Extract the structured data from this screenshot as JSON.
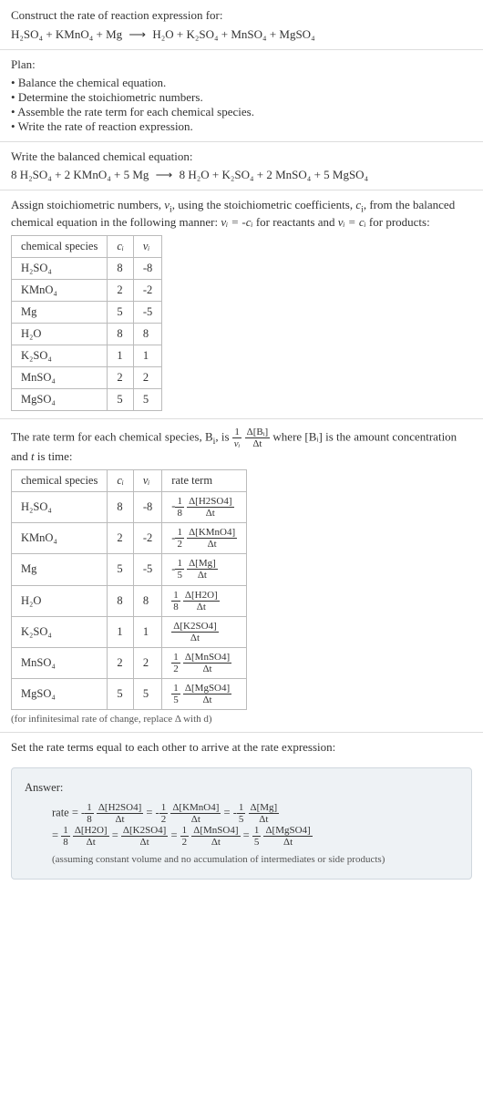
{
  "intro": {
    "prompt": "Construct the rate of reaction expression for:",
    "equation_lhs": "H₂SO₄ + KMnO₄ + Mg",
    "equation_rhs": "H₂O + K₂SO₄ + MnSO₄ + MgSO₄"
  },
  "plan": {
    "title": "Plan:",
    "items": [
      "Balance the chemical equation.",
      "Determine the stoichiometric numbers.",
      "Assemble the rate term for each chemical species.",
      "Write the rate of reaction expression."
    ]
  },
  "balanced": {
    "title": "Write the balanced chemical equation:",
    "lhs": "8 H₂SO₄ + 2 KMnO₄ + 5 Mg",
    "rhs": "8 H₂O + K₂SO₄ + 2 MnSO₄ + 5 MgSO₄"
  },
  "stoich": {
    "title_part1": "Assign stoichiometric numbers, ",
    "title_nu": "ν",
    "title_sub": "i",
    "title_part2": ", using the stoichiometric coefficients, ",
    "title_c": "c",
    "title_part3": ", from the balanced chemical equation in the following manner: ",
    "rel1": "νᵢ = -cᵢ",
    "rel1_after": " for reactants and ",
    "rel2": "νᵢ = cᵢ",
    "rel2_after": " for products:",
    "headers": [
      "chemical species",
      "cᵢ",
      "νᵢ"
    ],
    "rows": [
      {
        "species": "H₂SO₄",
        "c": "8",
        "nu": "-8"
      },
      {
        "species": "KMnO₄",
        "c": "2",
        "nu": "-2"
      },
      {
        "species": "Mg",
        "c": "5",
        "nu": "-5"
      },
      {
        "species": "H₂O",
        "c": "8",
        "nu": "8"
      },
      {
        "species": "K₂SO₄",
        "c": "1",
        "nu": "1"
      },
      {
        "species": "MnSO₄",
        "c": "2",
        "nu": "2"
      },
      {
        "species": "MgSO₄",
        "c": "5",
        "nu": "5"
      }
    ]
  },
  "rate_term": {
    "title_pre": "The rate term for each chemical species, B",
    "title_sub": "i",
    "title_mid": ", is ",
    "frac_coeff_num": "1",
    "frac_coeff_den": "νᵢ",
    "frac_main_num": "Δ[Bᵢ]",
    "frac_main_den": "Δt",
    "title_post1": " where [Bᵢ] is the amount concentration and ",
    "title_t": "t",
    "title_post2": " is time:",
    "headers": [
      "chemical species",
      "cᵢ",
      "νᵢ",
      "rate term"
    ],
    "rows": [
      {
        "species": "H₂SO₄",
        "c": "8",
        "nu": "-8",
        "sign": "-",
        "coeff_num": "1",
        "coeff_den": "8",
        "d_num": "Δ[H2SO4]",
        "d_den": "Δt"
      },
      {
        "species": "KMnO₄",
        "c": "2",
        "nu": "-2",
        "sign": "-",
        "coeff_num": "1",
        "coeff_den": "2",
        "d_num": "Δ[KMnO4]",
        "d_den": "Δt"
      },
      {
        "species": "Mg",
        "c": "5",
        "nu": "-5",
        "sign": "-",
        "coeff_num": "1",
        "coeff_den": "5",
        "d_num": "Δ[Mg]",
        "d_den": "Δt"
      },
      {
        "species": "H₂O",
        "c": "8",
        "nu": "8",
        "sign": "",
        "coeff_num": "1",
        "coeff_den": "8",
        "d_num": "Δ[H2O]",
        "d_den": "Δt"
      },
      {
        "species": "K₂SO₄",
        "c": "1",
        "nu": "1",
        "sign": "",
        "coeff_num": "",
        "coeff_den": "",
        "d_num": "Δ[K2SO4]",
        "d_den": "Δt"
      },
      {
        "species": "MnSO₄",
        "c": "2",
        "nu": "2",
        "sign": "",
        "coeff_num": "1",
        "coeff_den": "2",
        "d_num": "Δ[MnSO4]",
        "d_den": "Δt"
      },
      {
        "species": "MgSO₄",
        "c": "5",
        "nu": "5",
        "sign": "",
        "coeff_num": "1",
        "coeff_den": "5",
        "d_num": "Δ[MgSO4]",
        "d_den": "Δt"
      }
    ],
    "footnote": "(for infinitesimal rate of change, replace Δ with d)"
  },
  "final": {
    "title": "Set the rate terms equal to each other to arrive at the rate expression:"
  },
  "answer": {
    "label": "Answer:",
    "rate_prefix": "rate = ",
    "terms_line1": [
      {
        "sign": "-",
        "num": "1",
        "den": "8",
        "dnum": "Δ[H2SO4]",
        "dden": "Δt"
      },
      {
        "sign": "-",
        "num": "1",
        "den": "2",
        "dnum": "Δ[KMnO4]",
        "dden": "Δt"
      },
      {
        "sign": "-",
        "num": "1",
        "den": "5",
        "dnum": "Δ[Mg]",
        "dden": "Δt"
      }
    ],
    "line2_prefix": "= ",
    "terms_line2": [
      {
        "sign": "",
        "num": "1",
        "den": "8",
        "dnum": "Δ[H2O]",
        "dden": "Δt"
      },
      {
        "sign": "",
        "num": "",
        "den": "",
        "dnum": "Δ[K2SO4]",
        "dden": "Δt"
      },
      {
        "sign": "",
        "num": "1",
        "den": "2",
        "dnum": "Δ[MnSO4]",
        "dden": "Δt"
      },
      {
        "sign": "",
        "num": "1",
        "den": "5",
        "dnum": "Δ[MgSO4]",
        "dden": "Δt"
      }
    ],
    "note": "(assuming constant volume and no accumulation of intermediates or side products)"
  },
  "glyphs": {
    "arrow": "⟶",
    "eq": " = "
  }
}
